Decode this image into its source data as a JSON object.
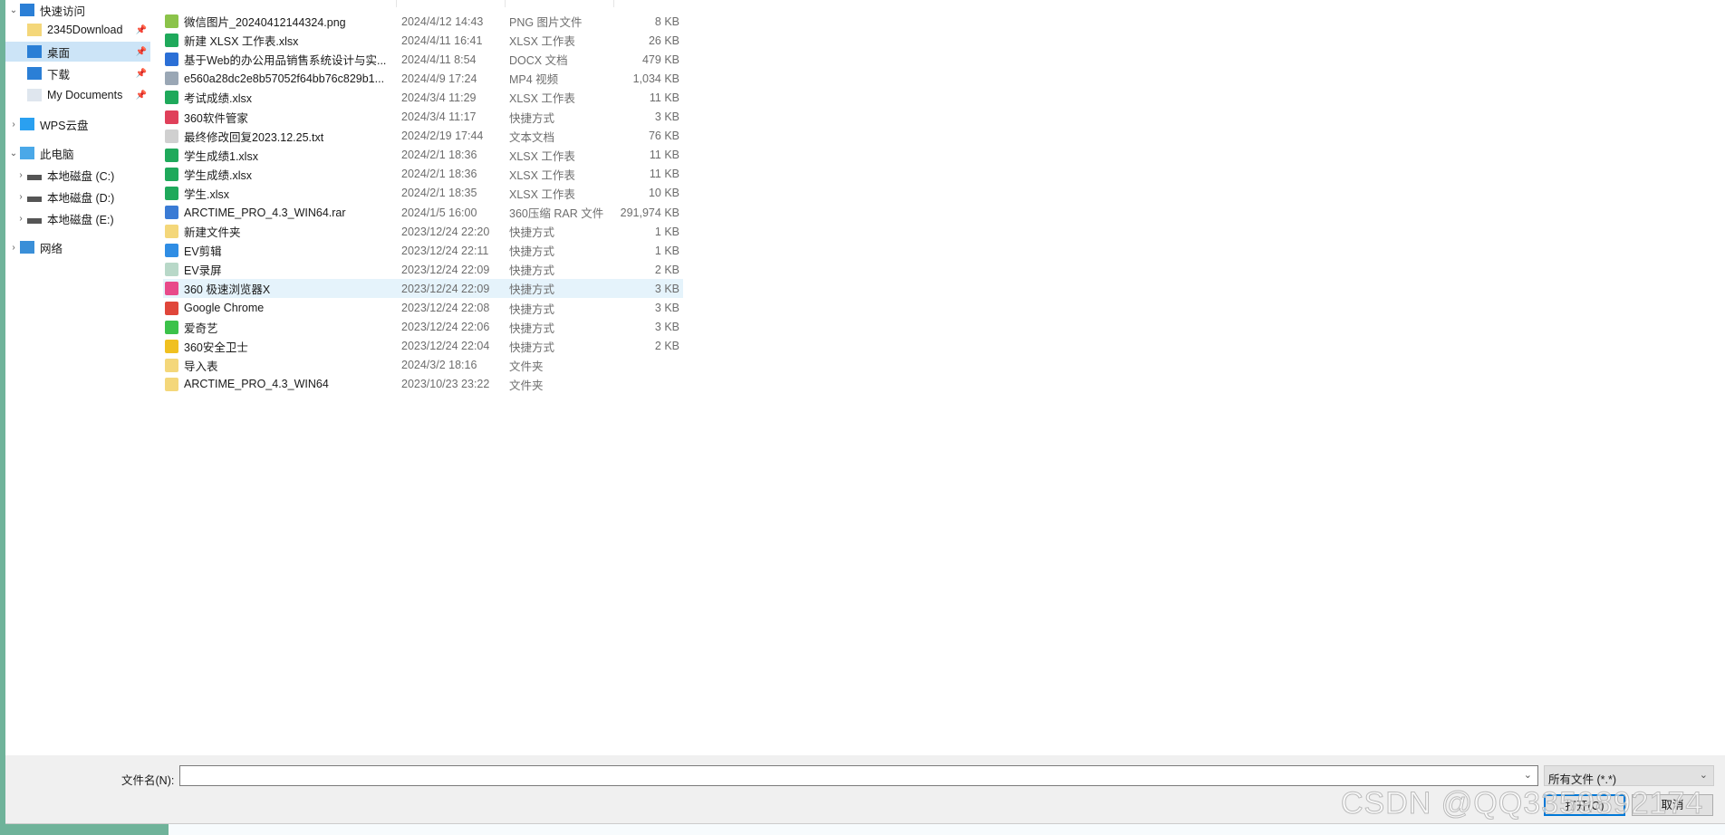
{
  "sidebar": {
    "items": [
      {
        "label": "快速访问",
        "icon": "star-icon",
        "expanded": true,
        "level": 0
      },
      {
        "label": "2345Download",
        "icon": "folder-icon",
        "pinned": true,
        "level": 1
      },
      {
        "label": "桌面",
        "icon": "desktop-icon",
        "pinned": true,
        "level": 1,
        "selected": true
      },
      {
        "label": "下载",
        "icon": "download-icon",
        "pinned": true,
        "level": 1
      },
      {
        "label": "My Documents",
        "icon": "document-icon",
        "pinned": true,
        "level": 1
      },
      {
        "label": "WPS云盘",
        "icon": "cloud-icon",
        "level": 0
      },
      {
        "label": "此电脑",
        "icon": "computer-icon",
        "expanded": true,
        "level": 0
      },
      {
        "label": "本地磁盘 (C:)",
        "icon": "drive-icon",
        "level": 1
      },
      {
        "label": "本地磁盘 (D:)",
        "icon": "drive-icon",
        "level": 1
      },
      {
        "label": "本地磁盘 (E:)",
        "icon": "drive-icon",
        "level": 1
      },
      {
        "label": "网络",
        "icon": "network-icon",
        "level": 0
      }
    ]
  },
  "files": [
    {
      "name": "微信图片_20240412144324.png",
      "date": "2024/4/12 14:43",
      "type": "PNG 图片文件",
      "size": "8 KB",
      "color": "#8bc34a"
    },
    {
      "name": "新建 XLSX 工作表.xlsx",
      "date": "2024/4/11 16:41",
      "type": "XLSX 工作表",
      "size": "26 KB",
      "color": "#1fa95b"
    },
    {
      "name": "基于Web的办公用品销售系统设计与实...",
      "date": "2024/4/11 8:54",
      "type": "DOCX 文档",
      "size": "479 KB",
      "color": "#2b6fd6"
    },
    {
      "name": "e560a28dc2e8b57052f64bb76c829b1...",
      "date": "2024/4/9 17:24",
      "type": "MP4 视频",
      "size": "1,034 KB",
      "color": "#9aa7b5"
    },
    {
      "name": "考试成绩.xlsx",
      "date": "2024/3/4 11:29",
      "type": "XLSX 工作表",
      "size": "11 KB",
      "color": "#1fa95b"
    },
    {
      "name": "360软件管家",
      "date": "2024/3/4 11:17",
      "type": "快捷方式",
      "size": "3 KB",
      "color": "#e0405a"
    },
    {
      "name": "最终修改回复2023.12.25.txt",
      "date": "2024/2/19 17:44",
      "type": "文本文档",
      "size": "76 KB",
      "color": "#d0d0d0"
    },
    {
      "name": "学生成绩1.xlsx",
      "date": "2024/2/1 18:36",
      "type": "XLSX 工作表",
      "size": "11 KB",
      "color": "#1fa95b"
    },
    {
      "name": "学生成绩.xlsx",
      "date": "2024/2/1 18:36",
      "type": "XLSX 工作表",
      "size": "11 KB",
      "color": "#1fa95b"
    },
    {
      "name": "学生.xlsx",
      "date": "2024/2/1 18:35",
      "type": "XLSX 工作表",
      "size": "10 KB",
      "color": "#1fa95b"
    },
    {
      "name": "ARCTIME_PRO_4.3_WIN64.rar",
      "date": "2024/1/5 16:00",
      "type": "360压缩 RAR 文件",
      "size": "291,974 KB",
      "color": "#3a7bd5"
    },
    {
      "name": "新建文件夹",
      "date": "2023/12/24 22:20",
      "type": "快捷方式",
      "size": "1 KB",
      "color": "#f4d77a"
    },
    {
      "name": "EV剪辑",
      "date": "2023/12/24 22:11",
      "type": "快捷方式",
      "size": "1 KB",
      "color": "#2f8de4"
    },
    {
      "name": "EV录屏",
      "date": "2023/12/24 22:09",
      "type": "快捷方式",
      "size": "2 KB",
      "color": "#b8d8c8"
    },
    {
      "name": "360 极速浏览器X",
      "date": "2023/12/24 22:09",
      "type": "快捷方式",
      "size": "3 KB",
      "color": "#e84a8a",
      "hover": true
    },
    {
      "name": "Google Chrome",
      "date": "2023/12/24 22:08",
      "type": "快捷方式",
      "size": "3 KB",
      "color": "#e0463a"
    },
    {
      "name": "爱奇艺",
      "date": "2023/12/24 22:06",
      "type": "快捷方式",
      "size": "3 KB",
      "color": "#3cc24a"
    },
    {
      "name": "360安全卫士",
      "date": "2023/12/24 22:04",
      "type": "快捷方式",
      "size": "2 KB",
      "color": "#f0c020"
    },
    {
      "name": "导入表",
      "date": "2024/3/2 18:16",
      "type": "文件夹",
      "size": "",
      "color": "#f4d77a"
    },
    {
      "name": "ARCTIME_PRO_4.3_WIN64",
      "date": "2023/10/23 23:22",
      "type": "文件夹",
      "size": "",
      "color": "#f4d77a"
    }
  ],
  "bottom": {
    "filename_label": "文件名(N):",
    "filename_value": "",
    "filetype": "所有文件 (*.*)",
    "open_label": "打开(O)",
    "cancel_label": "取消"
  },
  "watermark": "CSDN @QQ3359892174",
  "colors": {
    "selected": "#cce4f7",
    "hover": "#e5f3fb",
    "accent": "#0078d7"
  }
}
